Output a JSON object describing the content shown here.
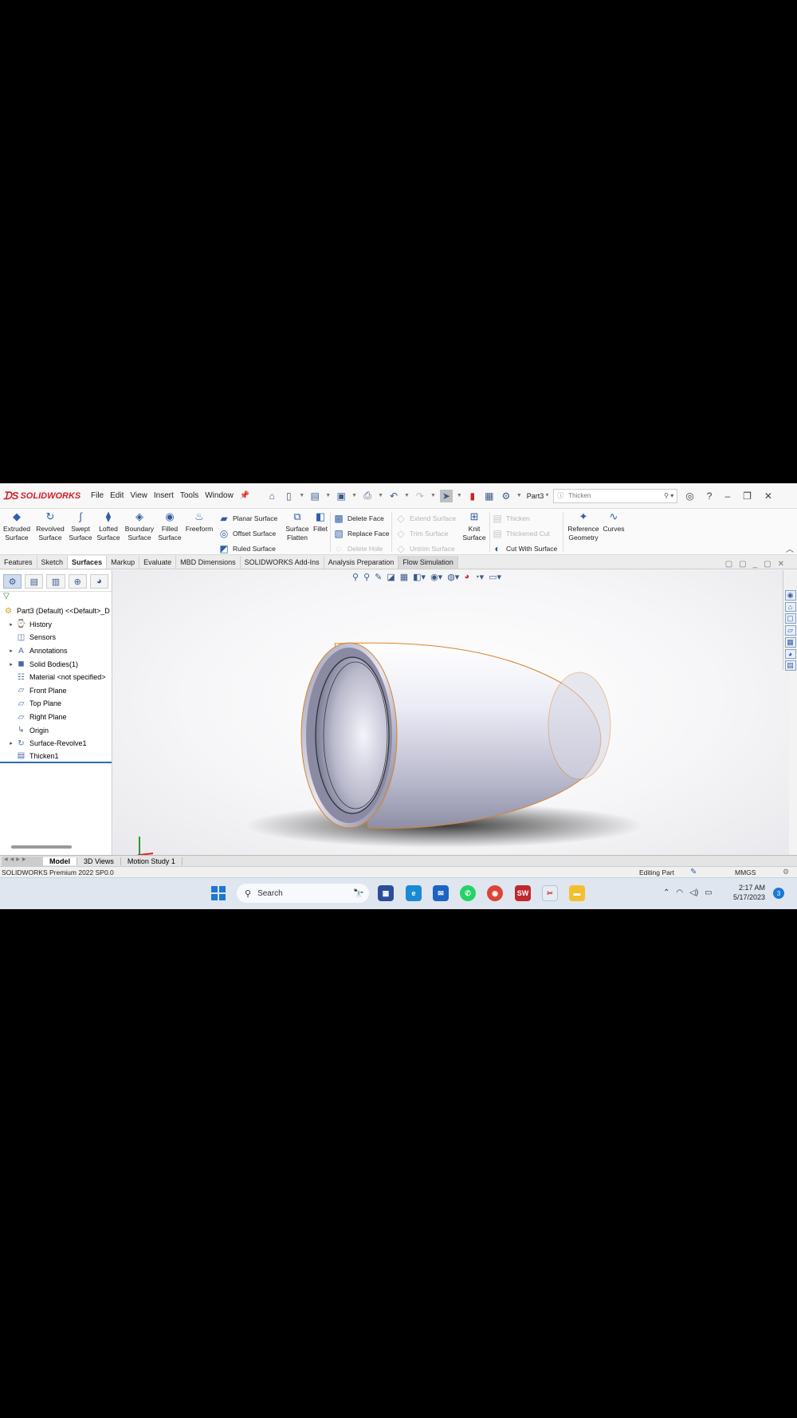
{
  "app": {
    "logo": "SOLIDWORKS",
    "menu": [
      "File",
      "Edit",
      "View",
      "Insert",
      "Tools",
      "Window"
    ],
    "document_title": "Part3 *",
    "search_placeholder": "Thicken"
  },
  "ribbon": {
    "large_tools": [
      {
        "line1": "Extruded",
        "line2": "Surface",
        "icon": "extruded-surface-icon"
      },
      {
        "line1": "Revolved",
        "line2": "Surface",
        "icon": "revolved-surface-icon"
      },
      {
        "line1": "Swept",
        "line2": "Surface",
        "icon": "swept-surface-icon"
      },
      {
        "line1": "Lofted",
        "line2": "Surface",
        "icon": "lofted-surface-icon"
      },
      {
        "line1": "Boundary",
        "line2": "Surface",
        "icon": "boundary-surface-icon"
      },
      {
        "line1": "Filled",
        "line2": "Surface",
        "icon": "filled-surface-icon"
      },
      {
        "line1": "Freeform",
        "line2": "",
        "icon": "freeform-icon"
      }
    ],
    "stack1": [
      "Planar Surface",
      "Offset Surface",
      "Ruled Surface"
    ],
    "surface_flatten": {
      "line1": "Surface",
      "line2": "Flatten"
    },
    "fillet": "Fillet",
    "stack2": [
      "Delete Face",
      "Replace Face",
      "Delete Hole"
    ],
    "stack3": [
      "Extend Surface",
      "Trim Surface",
      "Untrim Surface"
    ],
    "knit": {
      "line1": "Knit",
      "line2": "Surface"
    },
    "stack4": [
      "Thicken",
      "Thickened Cut",
      "Cut With Surface"
    ],
    "reference": {
      "line1": "Reference",
      "line2": "Geometry"
    },
    "curves": "Curves"
  },
  "command_tabs": [
    "Features",
    "Sketch",
    "Surfaces",
    "Markup",
    "Evaluate",
    "MBD Dimensions",
    "SOLIDWORKS Add-Ins",
    "Analysis Preparation",
    "Flow Simulation"
  ],
  "active_tab": "Surfaces",
  "feature_tree": {
    "root": "Part3 (Default) <<Default>_D",
    "items": [
      {
        "label": "History",
        "expandable": true,
        "icon": "history-icon"
      },
      {
        "label": "Sensors",
        "expandable": false,
        "icon": "sensor-icon"
      },
      {
        "label": "Annotations",
        "expandable": true,
        "icon": "annotation-icon"
      },
      {
        "label": "Solid Bodies(1)",
        "expandable": true,
        "icon": "solid-bodies-icon"
      },
      {
        "label": "Material <not specified>",
        "expandable": false,
        "icon": "material-icon"
      },
      {
        "label": "Front Plane",
        "expandable": false,
        "icon": "plane-icon"
      },
      {
        "label": "Top Plane",
        "expandable": false,
        "icon": "plane-icon"
      },
      {
        "label": "Right Plane",
        "expandable": false,
        "icon": "plane-icon"
      },
      {
        "label": "Origin",
        "expandable": false,
        "icon": "origin-icon"
      },
      {
        "label": "Surface-Revolve1",
        "expandable": true,
        "icon": "revolve-icon"
      },
      {
        "label": "Thicken1",
        "expandable": false,
        "icon": "thicken-icon"
      }
    ]
  },
  "bottom_tabs": [
    "Model",
    "3D Views",
    "Motion Study 1"
  ],
  "status": {
    "version": "SOLIDWORKS Premium 2022 SP0.0",
    "mode": "Editing Part",
    "units": "MMGS"
  },
  "taskbar": {
    "search": "Search",
    "time": "2:17 AM",
    "date": "5/17/2023",
    "notifications": "3"
  },
  "colors": {
    "brand": "#d3202a",
    "accent": "#2c6bbd",
    "edge": "#d9822b"
  }
}
